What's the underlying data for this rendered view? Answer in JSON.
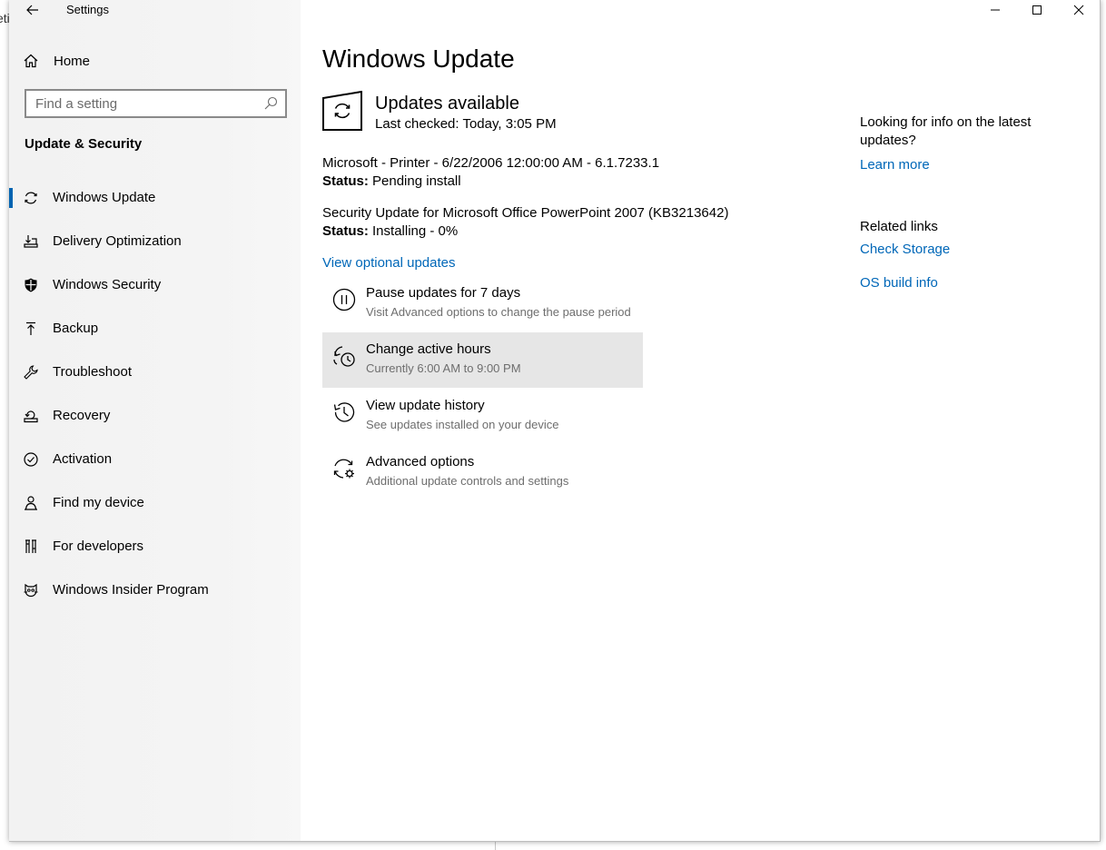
{
  "app": {
    "title": "Settings"
  },
  "sidebar": {
    "home_label": "Home",
    "search_placeholder": "Find a setting",
    "section_title": "Update & Security",
    "items": [
      {
        "label": "Windows Update",
        "icon": "sync-icon",
        "active": true
      },
      {
        "label": "Delivery Optimization",
        "icon": "delivery-optimization-icon"
      },
      {
        "label": "Windows Security",
        "icon": "shield-icon"
      },
      {
        "label": "Backup",
        "icon": "backup-arrow-icon"
      },
      {
        "label": "Troubleshoot",
        "icon": "wrench-icon"
      },
      {
        "label": "Recovery",
        "icon": "recovery-icon"
      },
      {
        "label": "Activation",
        "icon": "check-circle-icon"
      },
      {
        "label": "Find my device",
        "icon": "person-location-icon"
      },
      {
        "label": "For developers",
        "icon": "developer-tools-icon"
      },
      {
        "label": "Windows Insider Program",
        "icon": "insider-cat-icon"
      }
    ]
  },
  "main": {
    "title": "Windows Update",
    "status": {
      "title": "Updates available",
      "last_checked": "Last checked: Today, 3:05 PM"
    },
    "updates": [
      {
        "name": "Microsoft - Printer - 6/22/2006 12:00:00 AM - 6.1.7233.1",
        "status_label": "Status:",
        "status_value": "Pending install"
      },
      {
        "name": "Security Update for Microsoft Office PowerPoint 2007 (KB3213642)",
        "status_label": "Status:",
        "status_value": "Installing - 0%"
      }
    ],
    "optional_link": "View optional updates",
    "actions": [
      {
        "title": "Pause updates for 7 days",
        "subtitle": "Visit Advanced options to change the pause period",
        "icon": "pause-icon"
      },
      {
        "title": "Change active hours",
        "subtitle": "Currently 6:00 AM to 9:00 PM",
        "icon": "active-hours-icon",
        "hover": true
      },
      {
        "title": "View update history",
        "subtitle": "See updates installed on your device",
        "icon": "history-icon"
      },
      {
        "title": "Advanced options",
        "subtitle": "Additional update controls and settings",
        "icon": "advanced-options-icon"
      }
    ]
  },
  "aside": {
    "info_question": "Looking for info on the latest updates?",
    "learn_more": "Learn more",
    "related_title": "Related links",
    "related": [
      "Check Storage",
      "OS build info"
    ]
  },
  "background_fragments": {
    "left_top": "eti"
  },
  "colors": {
    "accent": "#0063b1",
    "link": "#0067b8",
    "sidebar_bg": "#f2f2f2",
    "hover_bg": "#e6e6e6",
    "secondary_text": "#6e6e6e"
  }
}
